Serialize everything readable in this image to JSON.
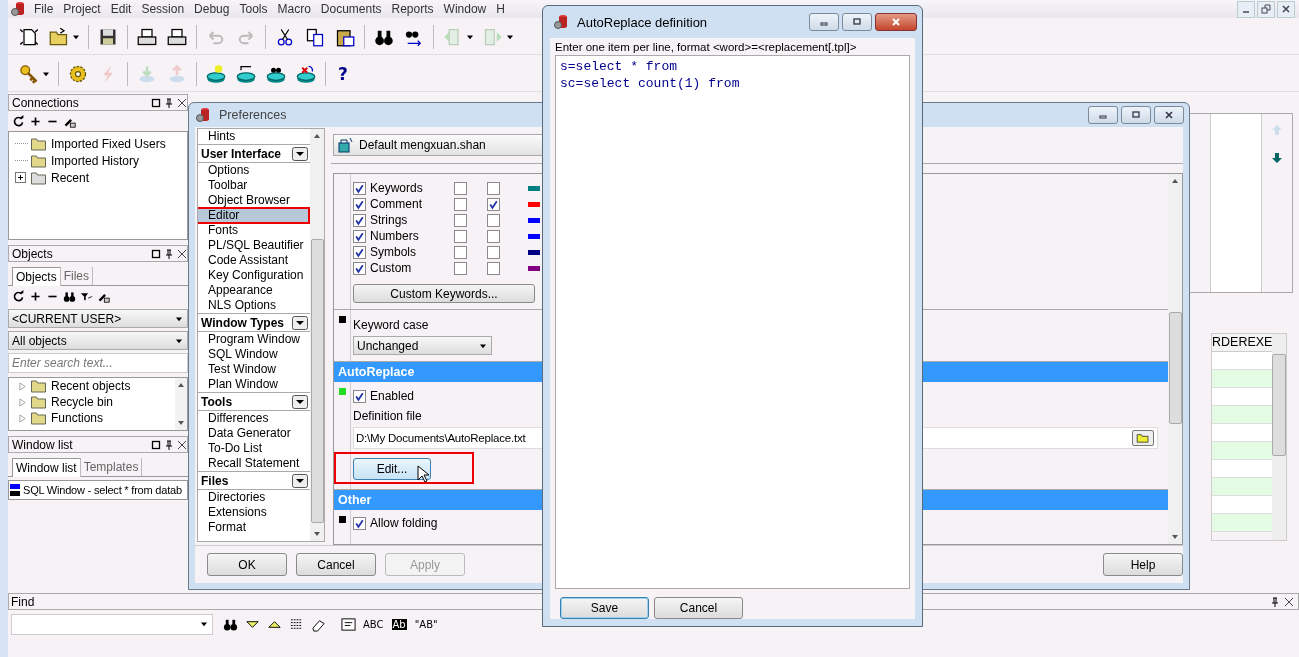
{
  "app": {
    "menu": [
      "File",
      "Project",
      "Edit",
      "Session",
      "Debug",
      "Tools",
      "Macro",
      "Documents",
      "Reports",
      "Window",
      "H"
    ],
    "help_glyph": "?"
  },
  "connections": {
    "title": "Connections",
    "items": [
      {
        "label": "Imported Fixed Users",
        "expander": false
      },
      {
        "label": "Imported History",
        "expander": false
      },
      {
        "label": "Recent",
        "expander": true
      }
    ]
  },
  "objects": {
    "title": "Objects",
    "tabs": [
      {
        "label": "Objects",
        "selected": true
      },
      {
        "label": "Files",
        "selected": false
      }
    ],
    "owner": "<CURRENT USER>",
    "filter": "All objects",
    "search": {
      "placeholder": "Enter search text..."
    },
    "items": [
      "Recent objects",
      "Recycle bin",
      "Functions"
    ]
  },
  "window_list": {
    "title": "Window list",
    "tabs": [
      {
        "label": "Window list",
        "selected": true
      },
      {
        "label": "Templates",
        "selected": false
      }
    ],
    "items": [
      "SQL Window - select * from datab"
    ]
  },
  "result_grid": {
    "columns": [
      "RDEREXE"
    ]
  },
  "find": {
    "title": "Find",
    "options": [
      "ABC",
      "Ab",
      "\"AB\""
    ]
  },
  "preferences": {
    "title": "Preferences",
    "profile": "Default mengxuan.shan",
    "groups": [
      {
        "items": [
          {
            "label": "Hints",
            "selected": false,
            "highlighted": false
          }
        ]
      },
      {
        "heading": "User Interface",
        "items": [
          {
            "label": "Options",
            "selected": false,
            "highlighted": false
          },
          {
            "label": "Toolbar",
            "selected": false,
            "highlighted": false
          },
          {
            "label": "Object Browser",
            "selected": false,
            "highlighted": false
          },
          {
            "label": "Editor",
            "selected": true,
            "highlighted": true
          },
          {
            "label": "Fonts",
            "selected": false,
            "highlighted": false
          },
          {
            "label": "PL/SQL Beautifier",
            "selected": false,
            "highlighted": false
          },
          {
            "label": "Code Assistant",
            "selected": false,
            "highlighted": false
          },
          {
            "label": "Key Configuration",
            "selected": false,
            "highlighted": false
          },
          {
            "label": "Appearance",
            "selected": false,
            "highlighted": false
          },
          {
            "label": "NLS Options",
            "selected": false,
            "highlighted": false
          }
        ]
      },
      {
        "heading": "Window Types",
        "items": [
          {
            "label": "Program Window",
            "selected": false,
            "highlighted": false
          },
          {
            "label": "SQL Window",
            "selected": false,
            "highlighted": false
          },
          {
            "label": "Test Window",
            "selected": false,
            "highlighted": false
          },
          {
            "label": "Plan Window",
            "selected": false,
            "highlighted": false
          }
        ]
      },
      {
        "heading": "Tools",
        "items": [
          {
            "label": "Differences",
            "selected": false,
            "highlighted": false
          },
          {
            "label": "Data Generator",
            "selected": false,
            "highlighted": false
          },
          {
            "label": "To-Do List",
            "selected": false,
            "highlighted": false
          },
          {
            "label": "Recall Statement",
            "selected": false,
            "highlighted": false
          }
        ]
      },
      {
        "heading": "Files",
        "items": [
          {
            "label": "Directories",
            "selected": false,
            "highlighted": false
          },
          {
            "label": "Extensions",
            "selected": false,
            "highlighted": false
          },
          {
            "label": "Format",
            "selected": false,
            "highlighted": false
          }
        ]
      }
    ],
    "syntax": [
      {
        "label": "Keywords",
        "enabled": true,
        "bold": false,
        "italic": false,
        "color": "#008080"
      },
      {
        "label": "Comment",
        "enabled": true,
        "bold": false,
        "italic": true,
        "color": "#ff0000"
      },
      {
        "label": "Strings",
        "enabled": true,
        "bold": false,
        "italic": false,
        "color": "#0000ff"
      },
      {
        "label": "Numbers",
        "enabled": true,
        "bold": false,
        "italic": false,
        "color": "#0000ff"
      },
      {
        "label": "Symbols",
        "enabled": true,
        "bold": false,
        "italic": false,
        "color": "#000080"
      },
      {
        "label": "Custom",
        "enabled": true,
        "bold": false,
        "italic": false,
        "color": "#800080"
      }
    ],
    "custom_keywords_button": "Custom Keywords...",
    "keyword_case": {
      "label": "Keyword case",
      "value": "Unchanged"
    },
    "autoreplace": {
      "heading": "AutoReplace",
      "enabled": {
        "label": "Enabled",
        "checked": true
      },
      "file_label": "Definition file",
      "file": "D:\\My Documents\\AutoReplace.txt",
      "edit_button": {
        "label": "Edit...",
        "highlighted": true
      }
    },
    "other": {
      "heading": "Other",
      "allow_folding": {
        "label": "Allow folding",
        "checked": true
      }
    },
    "buttons": [
      {
        "label": "OK",
        "disabled": false
      },
      {
        "label": "Cancel",
        "disabled": false
      },
      {
        "label": "Apply",
        "disabled": true
      }
    ],
    "help_button": "Help"
  },
  "autoreplace_dialog": {
    "title": "AutoReplace definition",
    "hint": "Enter one item per line, format <word>=<replacement[.tpl]>",
    "lines": [
      "s=select * from",
      "sc=select count(1) from"
    ],
    "buttons": [
      {
        "label": "Save",
        "default": true
      },
      {
        "label": "Cancel",
        "default": false
      }
    ]
  }
}
